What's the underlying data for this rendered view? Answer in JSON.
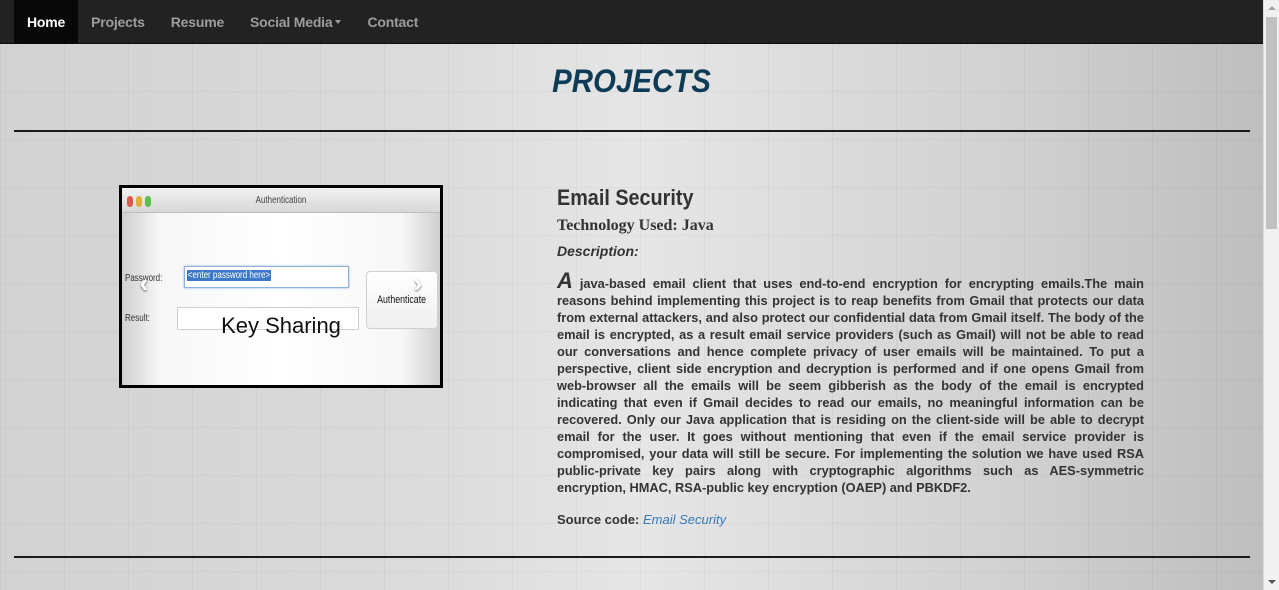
{
  "nav": {
    "items": [
      {
        "label": "Home",
        "active": true
      },
      {
        "label": "Projects",
        "active": false
      },
      {
        "label": "Resume",
        "active": false
      },
      {
        "label": "Social Media",
        "active": false,
        "dropdown": true
      },
      {
        "label": "Contact",
        "active": false
      }
    ]
  },
  "page": {
    "title": "PROJECTS"
  },
  "carousel": {
    "window_title": "Authentication",
    "password_label": "Password:",
    "password_value": "<enter password here>",
    "result_label": "Result:",
    "button_label": "Authenticate",
    "caption": "Key Sharing",
    "slide_count": 3,
    "active_slide": 1,
    "prev_icon": "chevron-left-icon",
    "next_icon": "chevron-right-icon"
  },
  "project": {
    "title": "Email Security",
    "technology": "Technology Used: Java",
    "description_label": "Description:",
    "description_first_letter": "A",
    "description_rest": " java-based email client that uses end-to-end encryption for encrypting emails.The main reasons behind implementing this project is to reap benefits from Gmail that protects our data from external attackers, and also protect our confidential data from Gmail itself. The body of the email is encrypted, as a result email service providers (such as Gmail) will not be able to read our conversations and hence complete privacy of user emails will be maintained. To put a perspective, client side encryption and decryption is performed and if one opens Gmail from web-browser all the emails will be seem gibberish as the body of the email is encrypted indicating that even if Gmail decides to read our emails, no meaningful information can be recovered. Only our Java application that is residing on the client-side will be able to decrypt email for the user. It goes without mentioning that even if the email service provider is compromised, your data will still be secure. For implementing the solution we have used RSA public-private key pairs along with cryptographic algorithms such as AES-symmetric encryption, HMAC, RSA-public key encryption (OAEP) and PBKDF2.",
    "source_label": "Source code:",
    "source_link_text": "Email Security"
  },
  "colors": {
    "navbar": "#222222",
    "nav_active": "#080808",
    "title": "#0e3b55",
    "link": "#337ab7"
  }
}
